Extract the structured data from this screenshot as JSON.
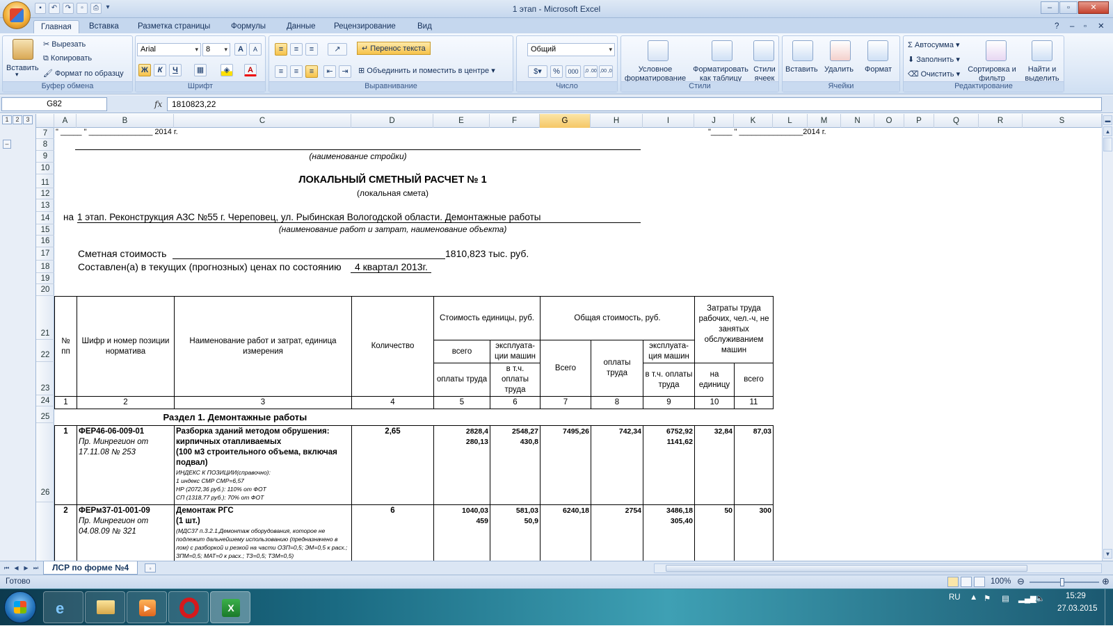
{
  "window": {
    "title": "1 этап - Microsoft Excel"
  },
  "ribbon": {
    "tabs": [
      "Главная",
      "Вставка",
      "Разметка страницы",
      "Формулы",
      "Данные",
      "Рецензирование",
      "Вид"
    ],
    "clipboard": {
      "title": "Буфер обмена",
      "paste": "Вставить",
      "cut": "Вырезать",
      "copy": "Копировать",
      "format_painter": "Формат по образцу"
    },
    "font": {
      "title": "Шрифт",
      "name": "Arial",
      "size": "8",
      "bold": "Ж",
      "italic": "К",
      "underline": "Ч",
      "grow": "A",
      "shrink": "A",
      "color": "A"
    },
    "alignment": {
      "title": "Выравнивание",
      "wrap": "Перенос текста",
      "merge": "Объединить и поместить в центре"
    },
    "number": {
      "title": "Число",
      "format": "Общий",
      "percent": "%",
      "thousands": "000",
      "inc": ",0 .00",
      "dec": ",00 ,0"
    },
    "styles": {
      "title": "Стили",
      "conditional": "Условное форматирование",
      "as_table": "Форматировать как таблицу",
      "cell_styles": "Стили ячеек"
    },
    "cells": {
      "title": "Ячейки",
      "insert": "Вставить",
      "delete": "Удалить",
      "format": "Формат"
    },
    "editing": {
      "title": "Редактирование",
      "autosum": "Автосумма",
      "fill": "Заполнить",
      "clear": "Очистить",
      "sort": "Сортировка и фильтр",
      "find": "Найти и выделить"
    }
  },
  "formula_bar": {
    "name_box": "G82",
    "fx": "fx",
    "value": "1810823,22"
  },
  "outline_levels": [
    "1",
    "2",
    "3"
  ],
  "columns": [
    "A",
    "B",
    "C",
    "D",
    "E",
    "F",
    "G",
    "H",
    "I",
    "J",
    "K",
    "L",
    "M",
    "N",
    "O",
    "P",
    "Q",
    "R",
    "S"
  ],
  "rows": [
    "7",
    "8",
    "9",
    "10",
    "11",
    "12",
    "13",
    "14",
    "15",
    "16",
    "17",
    "18",
    "19",
    "20",
    "21",
    "22",
    "23",
    "24",
    "25",
    "26"
  ],
  "sheet": {
    "approve_left": "\" _____ \" _______________ 2014 г.",
    "approve_right": "\"_____ \" _______________2014 г.",
    "construction_caption": "(наименование стройки)",
    "doc_title": "ЛОКАЛЬНЫЙ СМЕТНЫЙ РАСЧЕТ № 1",
    "doc_subtitle": "(локальная смета)",
    "na": "на",
    "object_name": "1 этап. Реконструкция АЗС №55 г. Череповец, ул. Рыбинская Вологодской области. Демонтажные работы",
    "object_caption": "(наименование работ и затрат, наименование объекта)",
    "cost_label": "Сметная стоимость",
    "cost_value": "1810,823 тыс. руб.",
    "prices_label": "Составлен(а) в текущих (прогнозных) ценах по состоянию",
    "prices_value": "4 квартал 2013г."
  },
  "table": {
    "h_no": "№ пп",
    "h_code": "Шифр и номер позиции норматива",
    "h_name": "Наименование работ и затрат, единица измерения",
    "h_qty": "Количество",
    "h_unit_cost": "Стоимость единицы, руб.",
    "h_total_cost": "Общая стоимость, руб.",
    "h_labor": "Затраты труда рабочих, чел.-ч, не занятых обслуживанием машин",
    "h_all": "всего",
    "h_mach": "эксплуата-ции машин",
    "h_wages": "оплаты труда",
    "h_incl_wages": "в т.ч. оплаты труда",
    "h_total": "Всего",
    "h_wages2": "оплаты труда",
    "h_mach2": "эксплуата-ция машин",
    "h_incl_wages2": "в т.ч. оплаты труда",
    "h_per_unit": "на единицу",
    "h_all2": "всего",
    "col_numbers": [
      "1",
      "2",
      "3",
      "4",
      "5",
      "6",
      "7",
      "8",
      "9",
      "10",
      "11"
    ],
    "section": "Раздел 1. Демонтажные работы",
    "rows": [
      {
        "no": "1",
        "code": "ФЕР46-06-009-01",
        "ref": "Пр. Минрегион от 17.11.08 № 253",
        "name": "Разборка зданий методом обрушения: кирпичных отапливаемых",
        "unit": "(100 м3 строительного объема, включая подвал)",
        "notes": [
          "ИНДЕКС К ПОЗИЦИИ(справочно):",
          "1 индекс СМР СМР=6,57",
          "НР (2072,36 руб.): 110% от ФОТ",
          "СП (1318,77 руб.): 70% от ФОТ"
        ],
        "qty": "2,65",
        "unit_all": "2828,4",
        "unit_wage": "280,13",
        "unit_mach": "2548,27",
        "unit_mach_wage": "430,8",
        "total": "7495,26",
        "total_wage": "742,34",
        "total_mach": "6752,92",
        "total_mach_wage": "1141,62",
        "labor_unit": "32,84",
        "labor_all": "87,03"
      },
      {
        "no": "2",
        "code": "ФЕРм37-01-001-09",
        "ref": "Пр. Минрегион от 04.08.09 № 321",
        "name": "Демонтаж РГС",
        "unit": "(1 шт.)",
        "notes": [
          "(МДС37 п.3.2.1.Демонтаж оборудования, которое не подлежит дальнейшему использованию (предназначено в лом) с разборкой и резкой на части ОЗП=0,5; ЭМ=0,5 к расх.; ЗПМ=0,5; МАТ=0 к расх.; ТЗ=0,5; ТЗМ=0,5)"
        ],
        "qty": "6",
        "unit_all": "1040,03",
        "unit_wage": "459",
        "unit_mach": "581,03",
        "unit_mach_wage": "50,9",
        "total": "6240,18",
        "total_wage": "2754",
        "total_mach": "3486,18",
        "total_mach_wage": "305,40",
        "labor_unit": "50",
        "labor_all": "300"
      }
    ]
  },
  "sheet_tab": "ЛСР по форме №4",
  "status": {
    "ready": "Готово",
    "zoom": "100%"
  },
  "taskbar": {
    "lang": "RU",
    "time": "15:29",
    "date": "27.03.2015"
  }
}
